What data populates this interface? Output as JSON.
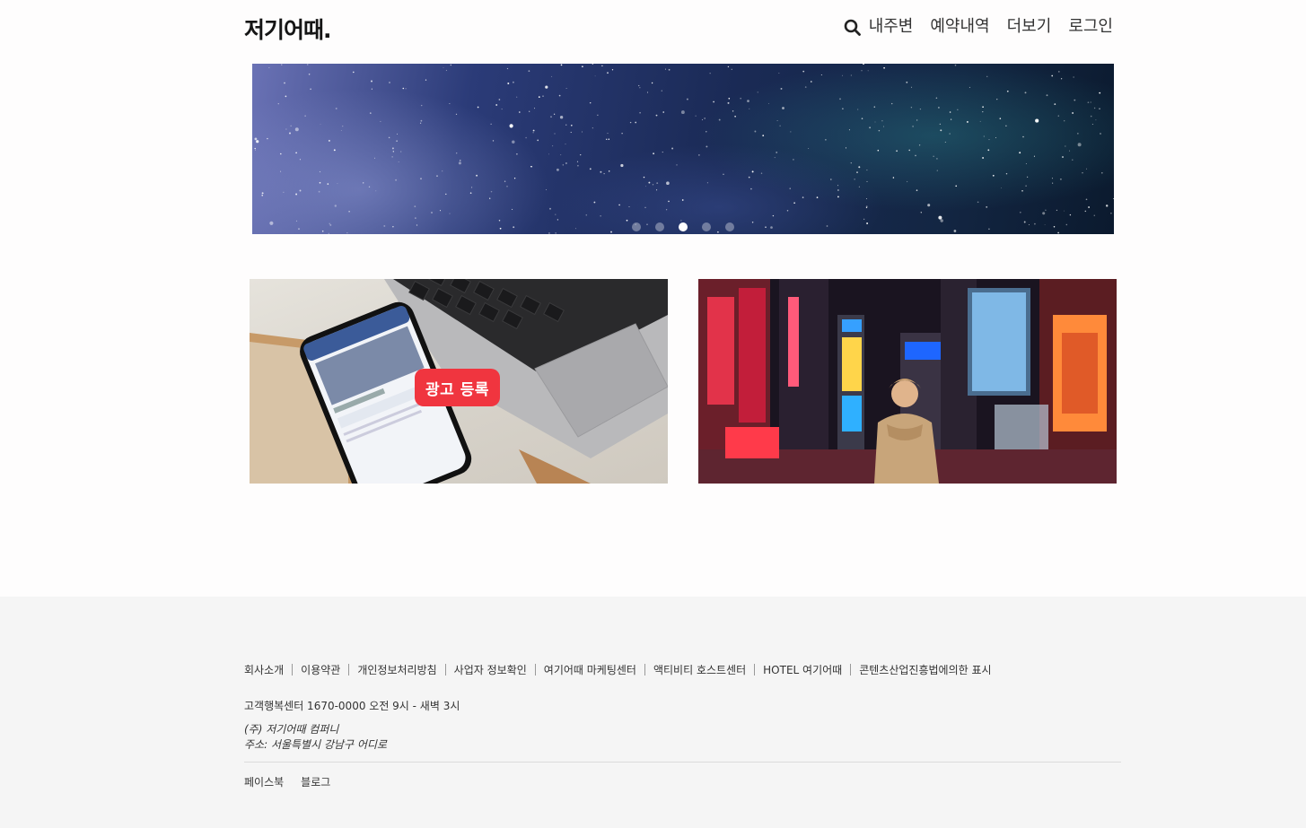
{
  "header": {
    "logo": "저기어때.",
    "nav": {
      "nearby": "내주변",
      "reservations": "예약내역",
      "more": "더보기",
      "login": "로그인"
    }
  },
  "banner": {
    "slide_count": 5,
    "active_slide": 3
  },
  "promo": {
    "ad_button": "광고 등록"
  },
  "footer": {
    "links": [
      "회사소개",
      "이용약관",
      "개인정보처리방침",
      "사업자 정보확인",
      "여기어때 마케팅센터",
      "액티비티 호스트센터",
      "HOTEL 여기어때",
      "콘텐츠산업진흥법에의한 표시"
    ],
    "customer_center": "고객행복센터 1670-0000 오전 9시 - 새벽 3시",
    "company_name": "(주) 저기어때 컴퍼니",
    "address": "주소: 서울특별시 강남구 어디로",
    "social": {
      "facebook": "페이스북",
      "blog": "블로그"
    }
  },
  "colors": {
    "accent": "#f0353f",
    "footer_bg": "#f5f5f5"
  }
}
